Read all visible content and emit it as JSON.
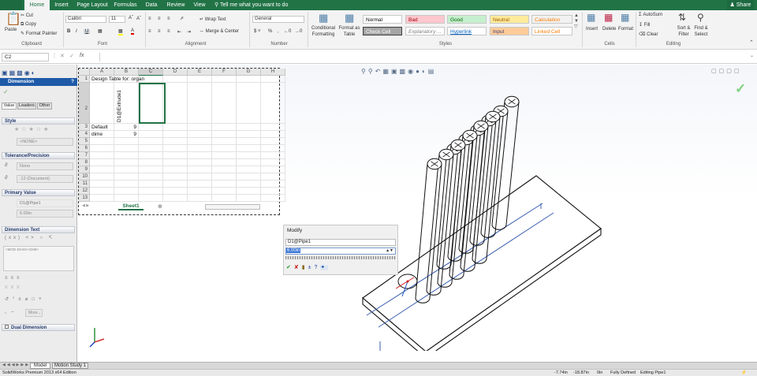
{
  "ribbon_tabs": [
    {
      "label": "Home",
      "active": true
    },
    {
      "label": "Insert"
    },
    {
      "label": "Page Layout"
    },
    {
      "label": "Formulas"
    },
    {
      "label": "Data"
    },
    {
      "label": "Review"
    },
    {
      "label": "View"
    }
  ],
  "tell_me": "Tell me what you want to do",
  "share": "Share",
  "clipboard": {
    "paste": "Paste",
    "cut": "Cut",
    "copy": "Copy",
    "format_painter": "Format Painter",
    "label": "Clipboard"
  },
  "font": {
    "name": "Calibri",
    "size": "11",
    "label": "Font"
  },
  "alignment": {
    "wrap": "Wrap Text",
    "merge": "Merge & Center",
    "label": "Alignment"
  },
  "number": {
    "format": "General",
    "label": "Number"
  },
  "styles": {
    "conditional": "Conditional Formatting",
    "format_table": "Format as Table",
    "label": "Styles",
    "cells": [
      {
        "text": "Normal",
        "bg": "#ffffff",
        "fg": "#000000"
      },
      {
        "text": "Bad",
        "bg": "#ffc7ce",
        "fg": "#9c0006"
      },
      {
        "text": "Good",
        "bg": "#c6efce",
        "fg": "#006100"
      },
      {
        "text": "Neutral",
        "bg": "#ffeb9c",
        "fg": "#9c5700"
      },
      {
        "text": "Calculation",
        "bg": "#f2f2f2",
        "fg": "#fa7d00"
      },
      {
        "text": "Check Cell",
        "bg": "#a5a5a5",
        "fg": "#ffffff"
      },
      {
        "text": "Explanatory ...",
        "bg": "#ffffff",
        "fg": "#7f7f7f"
      },
      {
        "text": "Hyperlink",
        "bg": "#ffffff",
        "fg": "#0563c1"
      },
      {
        "text": "Input",
        "bg": "#ffcc99",
        "fg": "#3f3f76"
      },
      {
        "text": "Linked Cell",
        "bg": "#ffffff",
        "fg": "#fa7d00"
      }
    ]
  },
  "cells_group": {
    "insert": "Insert",
    "delete": "Delete",
    "format": "Format",
    "label": "Cells"
  },
  "editing": {
    "autosum": "AutoSum",
    "fill": "Fill",
    "clear": "Clear",
    "sort": "Sort & Filter",
    "find": "Find & Select",
    "label": "Editing"
  },
  "namebox": "C2",
  "fx": "fx",
  "pm": {
    "title": "Dimension",
    "help": "?",
    "tabs": [
      "Value",
      "Leaders",
      "Other"
    ],
    "style_head": "Style",
    "style_field": "<NONE>",
    "tol_head": "Tolerance/Precision",
    "tol_none": "None",
    "tol_doc": ".12 (Document)",
    "primary_head": "Primary Value",
    "primary_name": "D1@Pipe1",
    "primary_val": "6.00in",
    "dimtext_head": "Dimension Text",
    "dimtext_val": "<MOD-DIAM><DIM>",
    "more": "More...",
    "dual": "Dual Dimension"
  },
  "excel": {
    "columns": [
      "A",
      "B",
      "C",
      "D",
      "E",
      "F",
      "G",
      "H"
    ],
    "rows": [
      "1",
      "2",
      "3",
      "4",
      "5",
      "6",
      "7",
      "8",
      "9",
      "10",
      "11",
      "12",
      "13"
    ],
    "a1": "Design Table for: organ",
    "b2": "D1@Extrude1",
    "a3": "Default",
    "b3": "9",
    "a4": "dime",
    "b4": "9",
    "sheet": "Sheet1"
  },
  "modify": {
    "title": "Modify",
    "name": "D1@Pipe1",
    "value": "6.00in"
  },
  "bottom_tabs": [
    "Model",
    "Motion Study 1"
  ],
  "status": {
    "edition": "SolidWorks Premium 2013 x64 Edition",
    "x": "-7.74in",
    "y": "-18.87in",
    "z": "0in",
    "state": "Fully Defined",
    "editing": "Editing Pipe1"
  },
  "colors": {
    "excel_green": "#217346",
    "sw_blue": "#1e5aa8"
  }
}
